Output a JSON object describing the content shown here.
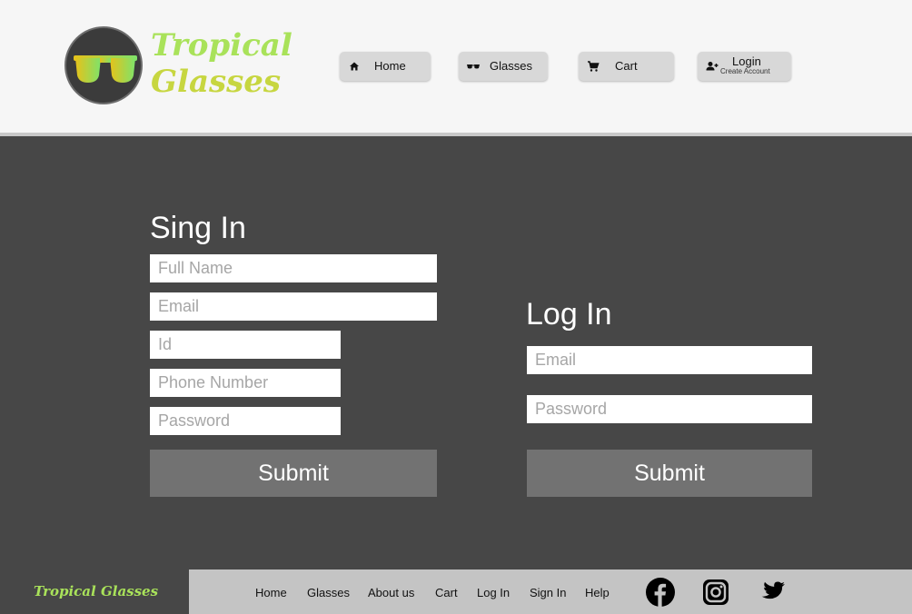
{
  "brand": {
    "line1": "Tropical",
    "line2": "Glasses",
    "footer": "Tropical Glasses"
  },
  "colors": {
    "brand_green": "#a9e25a",
    "brand_yellow": "#c7d640",
    "header_bg": "#f6f6f6",
    "body_bg": "#474747",
    "footer_bg": "#c4c4c4",
    "button_bg": "#727272"
  },
  "nav": {
    "home": {
      "label": "Home",
      "icon": "home-icon"
    },
    "glasses": {
      "label": "Glasses",
      "icon": "sunglasses-icon"
    },
    "cart": {
      "label": "Cart",
      "icon": "cart-icon"
    },
    "login": {
      "label": "Login",
      "sublabel": "Create Account",
      "icon": "add-user-icon"
    }
  },
  "signin": {
    "title": "Sing In",
    "fullname_placeholder": "Full Name",
    "email_placeholder": "Email",
    "id_placeholder": "Id",
    "phone_placeholder": "Phone Number",
    "password_placeholder": "Password",
    "submit_label": "Submit"
  },
  "login": {
    "title": "Log In",
    "email_placeholder": "Email",
    "password_placeholder": "Password",
    "submit_label": "Submit"
  },
  "footer": {
    "links": [
      "Home",
      "Glasses",
      "About us",
      "Cart",
      "Log In",
      "Sign In",
      "Help"
    ],
    "social": [
      "facebook-icon",
      "instagram-icon",
      "twitter-icon"
    ]
  }
}
